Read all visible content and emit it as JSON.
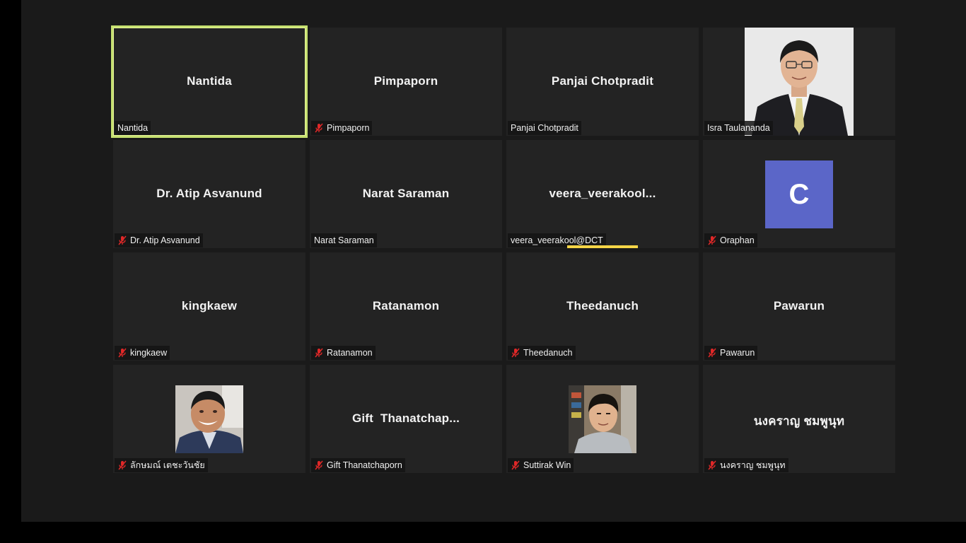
{
  "participants": [
    {
      "center": "Nantida",
      "label": "Nantida",
      "muted": false,
      "active": true
    },
    {
      "center": "Pimpaporn",
      "label": "Pimpaporn",
      "muted": true
    },
    {
      "center": "Panjai Chotpradit",
      "label": "Panjai Chotpradit",
      "muted": false
    },
    {
      "center": "",
      "label": "Isra Taulananda",
      "muted": false,
      "video": "man-in-suit"
    },
    {
      "center": "Dr. Atip Asvanund",
      "label": "Dr. Atip Asvanund",
      "muted": true
    },
    {
      "center": "Narat Saraman",
      "label": "Narat Saraman",
      "muted": false
    },
    {
      "center": "veera_veerakool...",
      "label": "veera_veerakool@DCT",
      "muted": false,
      "speaking": true
    },
    {
      "center": "",
      "label": "Oraphan",
      "muted": true,
      "avatar_letter": "C"
    },
    {
      "center": "kingkaew",
      "label": "kingkaew",
      "muted": true
    },
    {
      "center": "Ratanamon",
      "label": "Ratanamon",
      "muted": true
    },
    {
      "center": "Theedanuch",
      "label": "Theedanuch",
      "muted": true
    },
    {
      "center": "Pawarun",
      "label": "Pawarun",
      "muted": true
    },
    {
      "center": "",
      "label": "ลักษมณ์ เตชะวันชัย",
      "muted": true,
      "photo": "smiling-man"
    },
    {
      "center": "Gift  Thanatchap...",
      "label": "Gift Thanatchaporn",
      "muted": true
    },
    {
      "center": "",
      "label": "Suttirak Win",
      "muted": true,
      "photo": "young-man"
    },
    {
      "center": "นงคราญ ชมพูนุท",
      "label": "นงคราญ ชมพูนุท",
      "muted": true
    }
  ],
  "colors": {
    "active_border": "#c6e070",
    "speaking_bar": "#f5d547",
    "avatar_bg": "#5b66c8",
    "muted_icon": "#e02828",
    "tile_bg": "#232323"
  }
}
